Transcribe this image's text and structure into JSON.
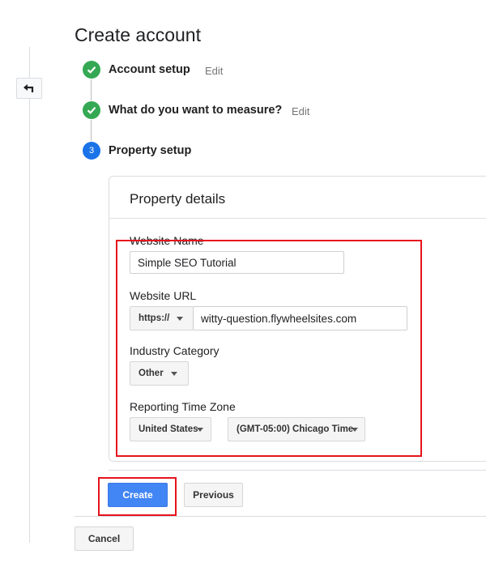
{
  "page": {
    "title": "Create account"
  },
  "steps": [
    {
      "number": "",
      "label": "Account setup",
      "edit": "Edit",
      "status": "complete"
    },
    {
      "number": "",
      "label": "What do you want to measure?",
      "edit": "Edit",
      "status": "complete"
    },
    {
      "number": "3",
      "label": "Property setup",
      "edit": "",
      "status": "active"
    }
  ],
  "property": {
    "title": "Property details",
    "website_name_label": "Website Name",
    "website_name_value": "Simple SEO Tutorial",
    "website_url_label": "Website URL",
    "protocol_value": "https://",
    "website_url_value": "witty-question.flywheelsites.com",
    "industry_label": "Industry Category",
    "industry_value": "Other",
    "timezone_label": "Reporting Time Zone",
    "country_value": "United States",
    "timezone_value": "(GMT-05:00) Chicago Time"
  },
  "actions": {
    "create": "Create",
    "previous": "Previous",
    "cancel": "Cancel"
  },
  "colors": {
    "step_complete": "#34a853",
    "step_active": "#1a73e8",
    "primary_button": "#4285f4",
    "highlight": "#e6131b"
  },
  "icons": {
    "back": "back-arrow-icon",
    "complete": "checkmark-icon"
  }
}
